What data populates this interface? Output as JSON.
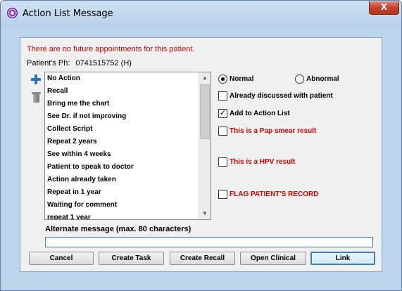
{
  "window": {
    "title": "Action List Message",
    "close_glyph": "X"
  },
  "message": {
    "text": "There are no future appointments for this patient.",
    "color": "#cc0000"
  },
  "phone": {
    "label": "Patient's Ph:",
    "value": "0741515752 (H)"
  },
  "toolbar": {
    "add_icon": "plus-icon",
    "delete_icon": "trash-icon"
  },
  "action_list": {
    "items": [
      "No Action",
      "Recall",
      "Bring me the chart",
      "See Dr. if not improving",
      "Collect Script",
      "Repeat 2 years",
      "See within 4 weeks",
      "Patient to speak to doctor",
      "Action already taken",
      "Repeat in 1 year",
      "Waiting for comment",
      "repeat 1 year"
    ],
    "scroll_up_glyph": "▲",
    "scroll_down_glyph": "▼"
  },
  "result": {
    "normal_label": "Normal",
    "abnormal_label": "Abnormal",
    "selected": "Normal"
  },
  "options": {
    "already_discussed": {
      "label": "Already discussed with patient",
      "checked": false
    },
    "add_to_action_list": {
      "label": "Add to Action List",
      "checked": true
    },
    "pap_smear": {
      "label": "This is a Pap smear result",
      "checked": false
    },
    "hpv": {
      "label": "This is a HPV result",
      "checked": false
    },
    "flag_record": {
      "label": "FLAG PATIENT'S RECORD",
      "checked": false
    },
    "check_glyph": "✓",
    "red_color": "#d40000"
  },
  "alternate_message": {
    "label": "Alternate message (max. 80 characters)",
    "value": ""
  },
  "buttons": {
    "cancel": "Cancel",
    "create_task": "Create Task",
    "create_recall": "Create Recall",
    "open_clinical": "Open Clinical",
    "link": "Link"
  }
}
